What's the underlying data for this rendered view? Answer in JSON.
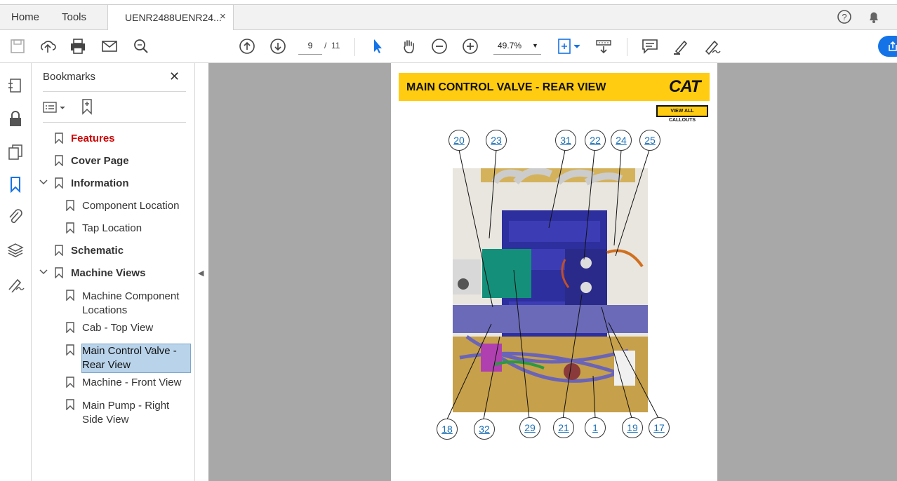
{
  "menu": {
    "home": "Home",
    "tools": "Tools"
  },
  "tab": {
    "title": "UENR2488UENR24...",
    "close": "×"
  },
  "toolbar": {
    "page_current": "9",
    "page_sep": "/",
    "page_total": "11",
    "zoom": "49.7%"
  },
  "panel": {
    "title": "Bookmarks",
    "close": "✕"
  },
  "bookmarks": [
    {
      "label": "Features"
    },
    {
      "label": "Cover Page"
    },
    {
      "label": "Information"
    },
    {
      "label": "Component Location"
    },
    {
      "label": "Tap Location"
    },
    {
      "label": "Schematic"
    },
    {
      "label": "Machine Views"
    },
    {
      "label": "Machine Component Locations"
    },
    {
      "label": "Cab - Top View"
    },
    {
      "label": "Main Control Valve - Rear View"
    },
    {
      "label": "Machine - Front View"
    },
    {
      "label": "Main Pump - Right Side View"
    }
  ],
  "doc": {
    "title": "MAIN CONTROL VALVE - REAR VIEW",
    "logo": "CAT",
    "view_all": "VIEW ALL CALLOUTS",
    "callouts_top": [
      "20",
      "23",
      "31",
      "22",
      "24",
      "25"
    ],
    "callouts_bottom": [
      "18",
      "32",
      "29",
      "21",
      "1",
      "19",
      "17"
    ]
  },
  "colors": {
    "banner": "#ffcc11",
    "accent": "#1473e6",
    "selection": "#b8d3ea",
    "callout_text": "#1a6fb5",
    "features_red": "#cc0000"
  }
}
